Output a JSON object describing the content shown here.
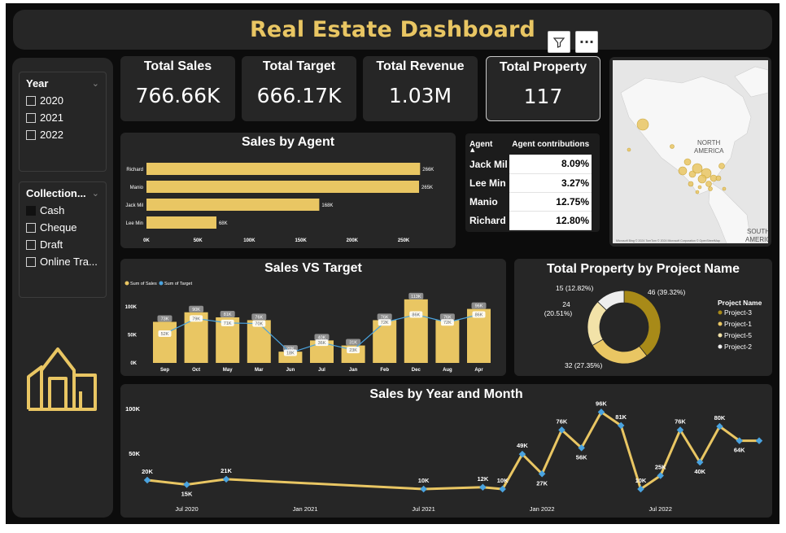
{
  "title": "Real Estate Dashboard",
  "toolbar": {
    "filter_icon": "filter-icon",
    "more_icon": "more-options-icon",
    "more_label": "···"
  },
  "slicers": {
    "year": {
      "title": "Year",
      "items": [
        "2020",
        "2021",
        "2022"
      ]
    },
    "collection": {
      "title": "Collection...",
      "items": [
        "Cash",
        "Cheque",
        "Draft",
        "Online Tra..."
      ]
    }
  },
  "kpis": [
    {
      "label": "Total Sales",
      "value": "766.66K"
    },
    {
      "label": "Total Target",
      "value": "666.17K"
    },
    {
      "label": "Total Revenue",
      "value": "1.03M"
    },
    {
      "label": "Total Property",
      "value": "117"
    }
  ],
  "agent_table": {
    "headers": [
      "Agent",
      "Agent contributions"
    ],
    "rows": [
      {
        "agent": "Jack Mil",
        "value": "8.09%"
      },
      {
        "agent": "Lee Min",
        "value": "3.27%"
      },
      {
        "agent": "Manio",
        "value": "12.75%"
      },
      {
        "agent": "Richard",
        "value": "12.80%"
      }
    ]
  },
  "map": {
    "label_north": "NORTH",
    "label_america": "AMERICA",
    "label_south": "SOUTH",
    "label_south2": "AMERIC",
    "attribution": "Microsoft Bing  © 2024 TomTom  © 2024 Microsoft Corporation  © OpenStreetMap",
    "colors": {
      "water": "#e6e6e6",
      "land": "#f7f7f7",
      "bubble": "#e9c663"
    }
  },
  "colors": {
    "gold": "#e9c663",
    "dark_gold": "#a88a18",
    "line_blue": "#4aa3df",
    "panel": "#262626"
  },
  "chart_data": [
    {
      "type": "bar",
      "title": "Sales by Agent",
      "orientation": "horizontal",
      "categories": [
        "Richard",
        "Manio",
        "Jack Mil",
        "Lee Min"
      ],
      "values": [
        266,
        265,
        168,
        68
      ],
      "value_labels": [
        "266K",
        "265K",
        "168K",
        "68K"
      ],
      "xticks": [
        "0K",
        "50K",
        "100K",
        "150K",
        "200K",
        "250K"
      ],
      "xlim": [
        0,
        280
      ]
    },
    {
      "type": "bar",
      "title": "Sales VS Target",
      "categories": [
        "Sep",
        "Oct",
        "May",
        "Mar",
        "Jun",
        "Jul",
        "Jan",
        "Feb",
        "Dec",
        "Aug",
        "Apr"
      ],
      "series": [
        {
          "name": "Sum of Sales",
          "kind": "bar",
          "values": [
            73,
            90,
            81,
            76,
            20,
            40,
            31,
            76,
            113,
            76,
            96
          ],
          "labels": [
            "73K",
            "90K",
            "81K",
            "76K",
            "20K",
            "40K",
            "31K",
            "76K",
            "113K",
            "76K",
            "96K"
          ]
        },
        {
          "name": "Sum of Target",
          "kind": "line",
          "values": [
            52,
            79,
            71,
            70,
            18,
            36,
            23,
            72,
            86,
            72,
            86
          ],
          "labels": [
            "52K",
            "79K",
            "71K",
            "70K",
            "18K",
            "36K",
            "23K",
            "72K",
            "86K",
            "72K",
            "86K"
          ]
        }
      ],
      "yticks": [
        "0K",
        "50K",
        "100K"
      ],
      "ylim": [
        0,
        120
      ]
    },
    {
      "type": "pie",
      "title": "Total Property by Project Name",
      "legend_title": "Project Name",
      "legend_position": "right",
      "categories": [
        "Project-3",
        "Project-1",
        "Project-5",
        "Project-2"
      ],
      "values": [
        46,
        32,
        24,
        15
      ],
      "labels": [
        "46 (39.32%)",
        "32 (27.35%)",
        "24 (20.51%)",
        "15 (12.82%)"
      ],
      "label_24_line1": "24",
      "label_24_line2": "(20.51%)",
      "colors": [
        "#a88a18",
        "#e9c663",
        "#f2e2a8",
        "#eeeeee"
      ]
    },
    {
      "type": "line",
      "title": "Sales by Year and Month",
      "x": [
        "2020-05",
        "2020-07",
        "2020-09",
        "2021-07",
        "2021-10",
        "2021-11",
        "2021-12",
        "2022-01",
        "2022-02",
        "2022-03",
        "2022-04",
        "2022-05",
        "2022-06",
        "2022-07",
        "2022-08",
        "2022-09",
        "2022-10",
        "2022-11",
        "2022-12"
      ],
      "values": [
        20,
        15,
        21,
        10,
        12,
        10,
        49,
        27,
        76,
        56,
        96,
        81,
        10,
        25,
        76,
        40,
        80,
        64,
        64
      ],
      "point_labels": [
        "20K",
        "15K",
        "21K",
        "10K",
        "12K",
        "10K",
        "49K",
        "27K",
        "76K",
        "56K",
        "96K",
        "81K",
        "10K",
        "25K",
        "76K",
        "40K",
        "80K",
        "64K",
        ""
      ],
      "xticks": [
        "Jul 2020",
        "Jan 2021",
        "Jul 2021",
        "Jan 2022",
        "Jul 2022"
      ],
      "yticks": [
        "50K",
        "100K"
      ],
      "ylim": [
        0,
        100
      ]
    }
  ]
}
